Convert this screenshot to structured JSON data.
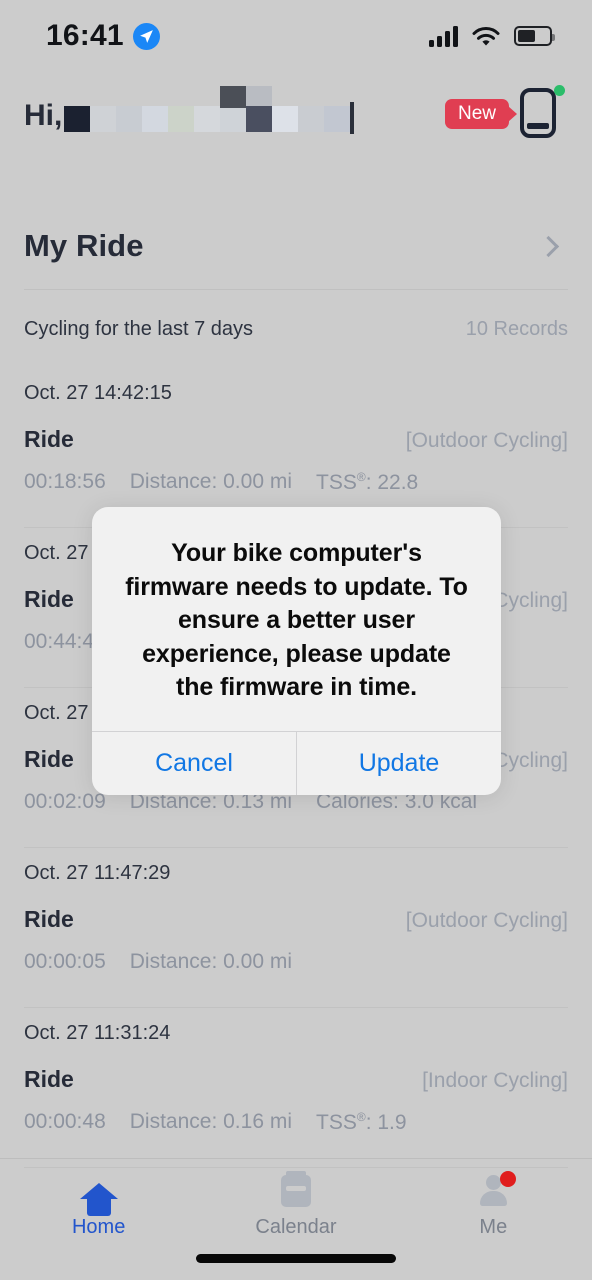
{
  "status_bar": {
    "time": "16:41",
    "location_icon": "location-arrow-icon",
    "signal_icon": "cellular-signal-icon",
    "wifi_icon": "wifi-icon",
    "battery_icon": "battery-icon",
    "battery_level_pct": 55
  },
  "header": {
    "greeting": "Hi,",
    "username_redacted": true,
    "new_badge_label": "New",
    "device_icon": "bike-computer-icon",
    "device_status_color": "#2bbd6a"
  },
  "my_ride": {
    "title": "My Ride",
    "chevron_icon": "chevron-right-icon",
    "subtitle": "Cycling for the last 7 days",
    "record_count": "10 Records"
  },
  "rides": [
    {
      "date": "Oct. 27 14:42:15",
      "name": "Ride",
      "type": "[Outdoor Cycling]",
      "duration": "00:18:56",
      "distance": "Distance: 0.00 mi",
      "metric_label": "TSS",
      "metric_sup": "®",
      "metric_value": ": 22.8"
    },
    {
      "date": "Oct. 27",
      "name": "Ride",
      "type": "Cycling]",
      "duration": "00:44:4",
      "distance": "",
      "metric_label": "",
      "metric_sup": "",
      "metric_value": ""
    },
    {
      "date": "Oct. 27",
      "name": "Ride",
      "type": "Cycling]",
      "duration": "00:02:09",
      "distance": "Distance: 0.13 mi",
      "metric_label": "Calories: 3.0 kcal",
      "metric_sup": "",
      "metric_value": ""
    },
    {
      "date": "Oct. 27 11:47:29",
      "name": "Ride",
      "type": "[Outdoor Cycling]",
      "duration": "00:00:05",
      "distance": "Distance: 0.00 mi",
      "metric_label": "",
      "metric_sup": "",
      "metric_value": ""
    },
    {
      "date": "Oct. 27 11:31:24",
      "name": "Ride",
      "type": "[Indoor Cycling]",
      "duration": "00:00:48",
      "distance": "Distance: 0.16 mi",
      "metric_label": "TSS",
      "metric_sup": "®",
      "metric_value": ": 1.9"
    }
  ],
  "modal": {
    "message": "Your bike computer's firmware needs to update. To ensure a better user experience, please update the firmware in time.",
    "cancel_label": "Cancel",
    "confirm_label": "Update",
    "accent_color": "#1177e4"
  },
  "tabbar": {
    "items": [
      {
        "label": "Home",
        "icon": "home-icon",
        "active": true,
        "badge": false
      },
      {
        "label": "Calendar",
        "icon": "calendar-icon",
        "active": false,
        "badge": false
      },
      {
        "label": "Me",
        "icon": "person-icon",
        "active": false,
        "badge": true
      }
    ]
  }
}
